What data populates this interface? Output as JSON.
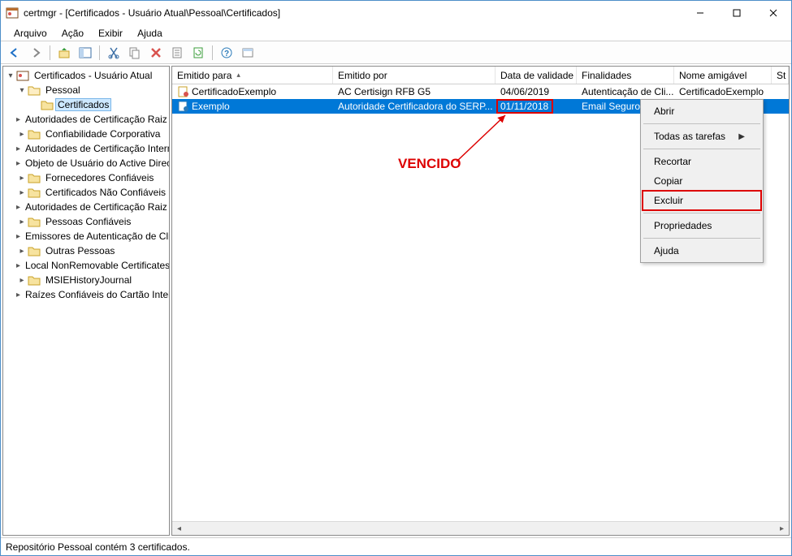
{
  "window": {
    "title": "certmgr - [Certificados - Usuário Atual\\Pessoal\\Certificados]"
  },
  "menu": {
    "arquivo": "Arquivo",
    "acao": "Ação",
    "exibir": "Exibir",
    "ajuda": "Ajuda"
  },
  "tree": {
    "root": "Certificados - Usuário Atual",
    "pessoal": "Pessoal",
    "certificados": "Certificados",
    "items": [
      "Autoridades de Certificação Raiz Confiáveis",
      "Confiabilidade Corporativa",
      "Autoridades de Certificação Intermediárias",
      "Objeto de Usuário do Active Directory",
      "Fornecedores Confiáveis",
      "Certificados Não Confiáveis",
      "Autoridades de Certificação Raiz de Terceiros",
      "Pessoas Confiáveis",
      "Emissores de Autenticação de Cliente",
      "Outras Pessoas",
      "Local NonRemovable Certificates",
      "MSIEHistoryJournal",
      "Raízes Confiáveis do Cartão Inteligente"
    ]
  },
  "columns": {
    "emitido_para": "Emitido para",
    "emitido_por": "Emitido por",
    "validade": "Data de validade",
    "finalidades": "Finalidades",
    "nome": "Nome amigável",
    "status": "St"
  },
  "rows": [
    {
      "para": "CertificadoExemplo",
      "por": "AC Certisign RFB G5",
      "validade": "04/06/2019",
      "fin": "Autenticação de Cli...",
      "nome": "CertificadoExemplo"
    },
    {
      "para": "Exemplo",
      "por": "Autoridade Certificadora do SERP...",
      "validade": "01/11/2018",
      "fin": "Email Seguro",
      "nome": ""
    }
  ],
  "context_menu": {
    "abrir": "Abrir",
    "todas": "Todas as tarefas",
    "recortar": "Recortar",
    "copiar": "Copiar",
    "excluir": "Excluir",
    "propriedades": "Propriedades",
    "ajuda": "Ajuda"
  },
  "status": "Repositório Pessoal contém 3 certificados.",
  "annotation": "VENCIDO"
}
